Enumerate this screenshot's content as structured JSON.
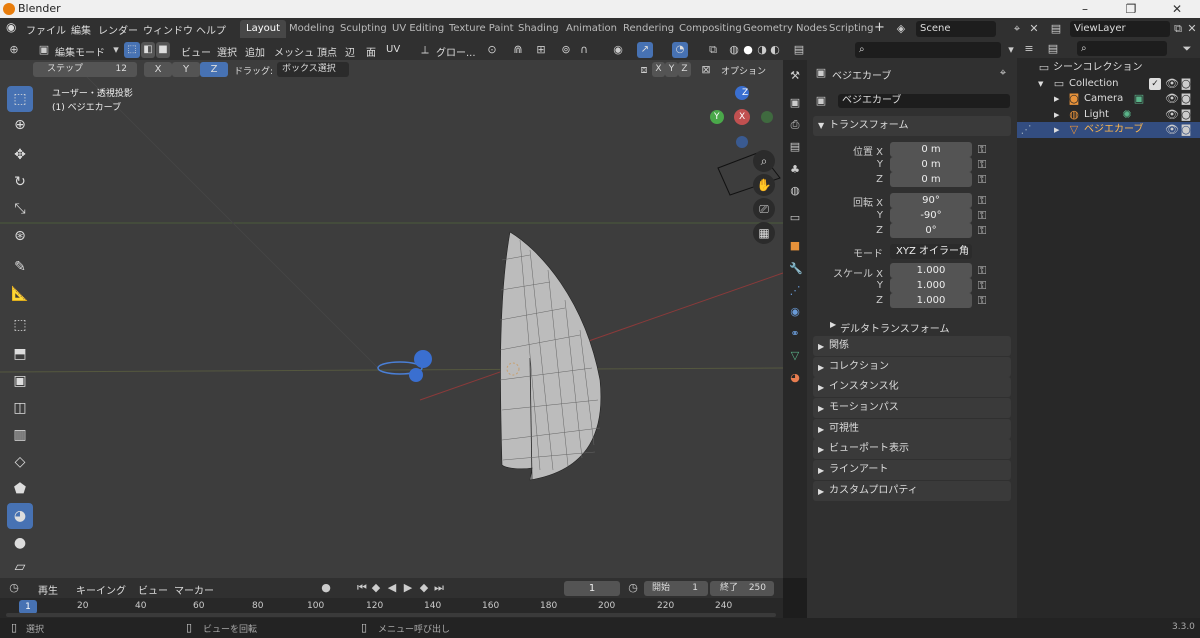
{
  "window": {
    "title": "Blender",
    "min_icon": "–",
    "max_icon": "❐",
    "close_icon": "✕"
  },
  "menubar": {
    "items": [
      "ファイル",
      "編集",
      "レンダー",
      "ウィンドウ",
      "ヘルプ"
    ],
    "workspaces": [
      "Layout",
      "Modeling",
      "Sculpting",
      "UV Editing",
      "Texture Paint",
      "Shading",
      "Animation",
      "Rendering",
      "Compositing",
      "Geometry Nodes",
      "Scripting"
    ],
    "active_workspace": "Layout",
    "add_workspace": "+",
    "scene": "Scene",
    "view_layer": "ViewLayer"
  },
  "viewport_header": {
    "mode": "編集モード",
    "menus": [
      "ビュー",
      "選択",
      "追加",
      "メッシュ",
      "頂点",
      "辺",
      "面",
      "UV"
    ],
    "transform_orientation": "グロー...",
    "step_label": "ステップ",
    "step_value": "12",
    "axes": [
      "X",
      "Y",
      "Z"
    ],
    "active_axis": "Z",
    "drag_label": "ドラッグ:",
    "drag_value": "ボックス選択",
    "options": "オプション",
    "mirror_axes": [
      "X",
      "Y",
      "Z"
    ]
  },
  "viewport": {
    "view_name": "ユーザー・透視投影",
    "object_name": "(1) ベジエカーブ",
    "gizmo": {
      "x": "X",
      "y": "Y",
      "z": "Z"
    }
  },
  "properties": {
    "object_name": "ベジエカーブ",
    "datablock": "ベジエカーブ",
    "transform_title": "トランスフォーム",
    "location_label": "位置",
    "rotation_label": "回転",
    "scale_label": "スケール",
    "axis_x": "X",
    "axis_y": "Y",
    "axis_z": "Z",
    "location": [
      "0 m",
      "0 m",
      "0 m"
    ],
    "rotation": [
      "90°",
      "-90°",
      "0°"
    ],
    "mode_label": "モード",
    "rotation_mode": "XYZ オイラー角",
    "scale": [
      "1.000",
      "1.000",
      "1.000"
    ],
    "delta_transform": "デルタトランスフォーム",
    "sections": [
      "関係",
      "コレクション",
      "インスタンス化",
      "モーションパス",
      "可視性",
      "ビューポート表示",
      "ラインアート",
      "カスタムプロパティ"
    ]
  },
  "outliner": {
    "root": "シーンコレクション",
    "collection": "Collection",
    "items": [
      "Camera",
      "Light",
      "ベジエカーブ"
    ],
    "selected": "ベジエカーブ"
  },
  "timeline": {
    "menus": [
      "再生",
      "キーイング",
      "ビュー",
      "マーカー"
    ],
    "current_frame": "1",
    "start_label": "開始",
    "start": "1",
    "end_label": "終了",
    "end": "250",
    "ticks": [
      "20",
      "40",
      "60",
      "80",
      "100",
      "120",
      "140",
      "160",
      "180",
      "200",
      "220",
      "240"
    ],
    "playhead": "1"
  },
  "statusbar": {
    "select": "選択",
    "rotate": "ビューを回転",
    "menu": "メニュー呼び出し",
    "version": "3.3.0"
  },
  "colors": {
    "accent": "#4772b3",
    "header": "#303030",
    "viewport": "#3d3d3d",
    "selected_row": "#334d80"
  }
}
